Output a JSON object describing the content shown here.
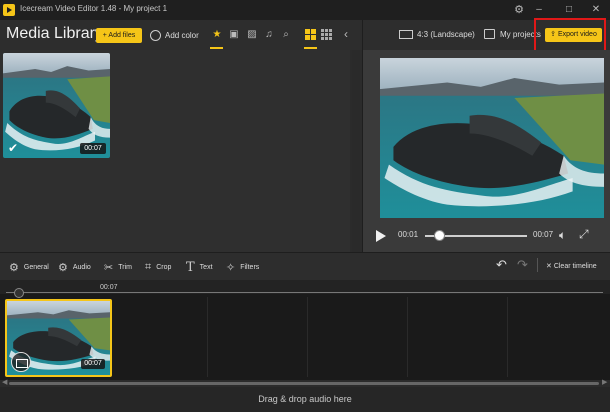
{
  "window": {
    "title": "Icecream Video Editor 1.48  -  My project 1",
    "minimize": "–",
    "maximize": "□",
    "close": "✕",
    "settings_icon": "gear-icon"
  },
  "library": {
    "title": "Media Library",
    "add_files": "+ Add files",
    "add_color": "Add color",
    "filters": [
      "star-icon",
      "film-icon",
      "image-icon",
      "music-icon",
      "search-icon"
    ],
    "views": [
      "grid-large-icon",
      "grid-small-icon"
    ],
    "items": [
      {
        "duration": "00:07",
        "selected": true
      }
    ]
  },
  "top_right": {
    "aspect": "4:3 (Landscape)",
    "projects": "My projects",
    "export": "Export video"
  },
  "player": {
    "current_time": "00:01",
    "total_time": "00:07",
    "progress": 0.14
  },
  "edit_tools": [
    {
      "label": "General",
      "icon": "gear-icon"
    },
    {
      "label": "Audio",
      "icon": "audio-settings-icon"
    },
    {
      "label": "Trim",
      "icon": "scissors-icon"
    },
    {
      "label": "Crop",
      "icon": "crop-icon"
    },
    {
      "label": "Text",
      "icon": "text-icon"
    },
    {
      "label": "Filters",
      "icon": "filters-icon"
    }
  ],
  "history": {
    "clear_timeline": "Clear timeline"
  },
  "timeline": {
    "ruler_time": "00:07",
    "clip_duration": "00:07",
    "audio_drop": "Drag & drop audio here"
  },
  "colors": {
    "accent": "#f5c518",
    "highlight": "#e01818",
    "background": "#2b2b2b"
  }
}
